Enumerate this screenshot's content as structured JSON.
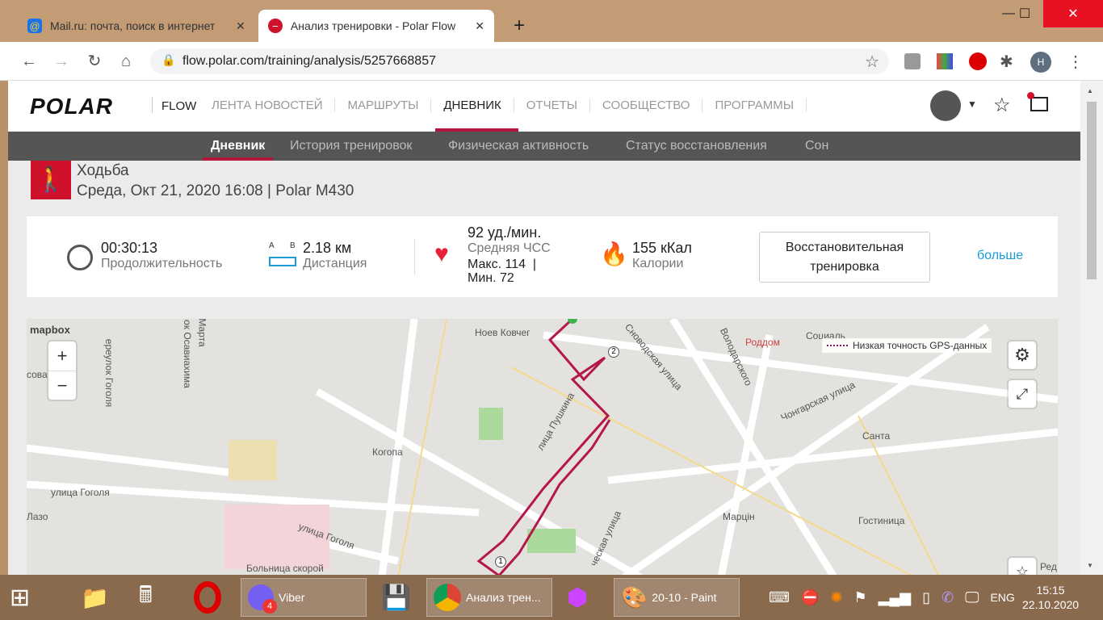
{
  "browser": {
    "tabs": [
      {
        "title": "Mail.ru: почта, поиск в интернет",
        "icon": "mailru-icon"
      },
      {
        "title": "Анализ тренировки - Polar Flow",
        "icon": "polar-icon"
      }
    ],
    "new_tab": "+",
    "url": "flow.polar.com/training/analysis/5257668857",
    "profile": "Н"
  },
  "header": {
    "logo": "POLAR",
    "flow": "FLOW",
    "nav": [
      "ЛЕНТА НОВОСТЕЙ",
      "МАРШРУТЫ",
      "ДНЕВНИК",
      "ОТЧЕТЫ",
      "СООБЩЕСТВО",
      "ПРОГРАММЫ"
    ],
    "active": "ДНЕВНИК"
  },
  "subnav": [
    "Дневник",
    "История тренировок",
    "Физическая активность",
    "Статус восстановления",
    "Сон"
  ],
  "activity": {
    "sport": "Ходьба",
    "date": "Среда, Окт 21, 2020 16:08 | Polar M430"
  },
  "summary": {
    "duration": "00:30:13",
    "duration_label": "Продолжительность",
    "dist_a": "A",
    "dist_b": "B",
    "distance": "2.18 км",
    "distance_label": "Дистанция",
    "hr": "92 уд./мин.",
    "hr_label": "Средняя ЧСС",
    "hr_max": "Макс. 114  |",
    "hr_min": "Мин. 72",
    "calories": "155 кКал",
    "calories_label": "Калории",
    "benefit": "Восстановительная тренировка",
    "more": "больше"
  },
  "map": {
    "attribution": "mapbox",
    "zoom_in": "+",
    "zoom_out": "−",
    "legend": "Низкая точность GPS-данных",
    "marker1": "1",
    "marker2": "2",
    "route_color": "#b5174b",
    "labels": [
      "Ноев Ковчег",
      "Роддом",
      "Социаль",
      "улок Осавиахима",
      "Марта",
      "ереулок Гоголя",
      "сова",
      "Когопа",
      "улица Гоголя",
      "Лазо",
      "улица Гоголя",
      "Больница скорой",
      "Сноводская улица",
      "лица Пушкина",
      "Володарского",
      "Чонгарская улица",
      "Санта",
      "Марцін",
      "Гостиница",
      "ческая улица",
      "Ред"
    ]
  },
  "taskbar": {
    "viber": "Viber",
    "viber_badge": "4",
    "chrome": "Анализ трен...",
    "paint": "20-10 - Paint",
    "lang": "ENG",
    "time": "15:15",
    "date": "22.10.2020"
  }
}
